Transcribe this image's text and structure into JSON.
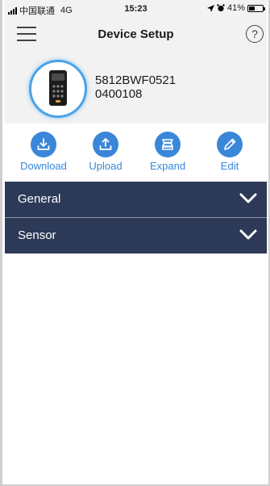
{
  "status_bar": {
    "carrier": "中国联通",
    "network": "4G",
    "time": "15:23",
    "battery_text": "41%",
    "battery_level": 0.41
  },
  "header": {
    "title": "Device Setup",
    "menu_icon": "hamburger-menu-icon",
    "help_label": "?"
  },
  "device": {
    "name_line1": "5812BWF0521",
    "name_line2": "0400108"
  },
  "actions": [
    {
      "label": "Download",
      "icon": "download-icon"
    },
    {
      "label": "Upload",
      "icon": "upload-icon"
    },
    {
      "label": "Expand",
      "icon": "expand-icon"
    },
    {
      "label": "Edit",
      "icon": "edit-pencil-icon"
    }
  ],
  "sections": [
    {
      "label": "General"
    },
    {
      "label": "Sensor"
    }
  ],
  "colors": {
    "accent": "#3a87d9",
    "section_bg": "#2c3a58",
    "header_bg": "#f2f2f2"
  }
}
